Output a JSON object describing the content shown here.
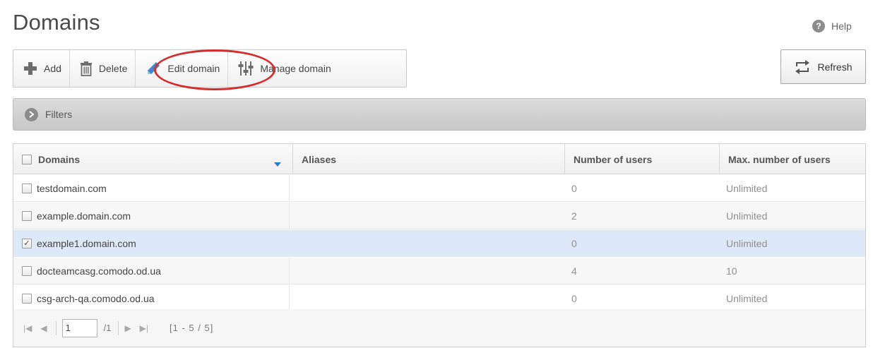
{
  "page": {
    "title": "Domains"
  },
  "help": {
    "label": "Help",
    "icon": "?"
  },
  "toolbar": {
    "add": "Add",
    "delete": "Delete",
    "edit": "Edit domain",
    "manage": "Manage domain"
  },
  "refresh": {
    "label": "Refresh"
  },
  "filters": {
    "label": "Filters"
  },
  "table": {
    "headers": {
      "domains": "Domains",
      "aliases": "Aliases",
      "users": "Number of users",
      "max": "Max. number of users"
    },
    "rows": [
      {
        "domain": "testdomain.com",
        "aliases": "",
        "users": "0",
        "max": "Unlimited",
        "checked": false
      },
      {
        "domain": "example.domain.com",
        "aliases": "",
        "users": "2",
        "max": "Unlimited",
        "checked": false
      },
      {
        "domain": "example1.domain.com",
        "aliases": "",
        "users": "0",
        "max": "Unlimited",
        "checked": true
      },
      {
        "domain": "docteamcasg.comodo.od.ua",
        "aliases": "",
        "users": "4",
        "max": "10",
        "checked": false
      },
      {
        "domain": "csg-arch-qa.comodo.od.ua",
        "aliases": "",
        "users": "0",
        "max": "Unlimited",
        "checked": false
      }
    ]
  },
  "pager": {
    "page_value": "1",
    "of_total": "/1",
    "range": "[1 - 5 / 5]"
  },
  "colors": {
    "selected_row": "#dde9f6",
    "annotation_ring": "#d42e2e",
    "edit_icon": "#3a86d8",
    "sort_arrow": "#2f78c4"
  }
}
